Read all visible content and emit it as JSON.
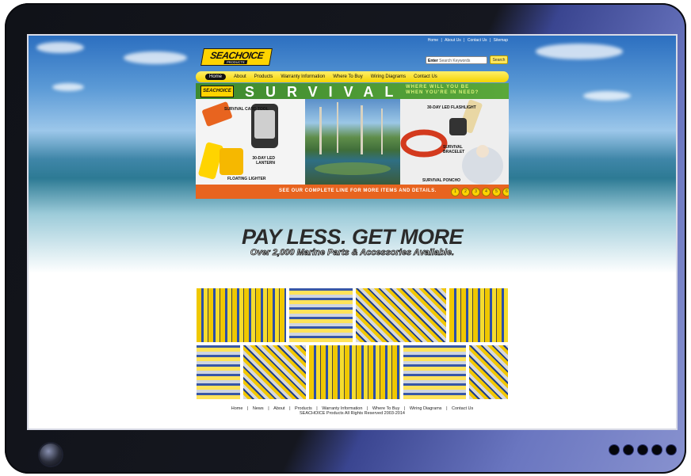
{
  "site": {
    "top_links": [
      "Home",
      "|",
      "About Us",
      "|",
      "Contact Us",
      "|",
      "Sitemap"
    ],
    "logo_text": "SEACHOICE",
    "logo_sub": "PRODUCTS",
    "search_prefix": "Enter",
    "search_placeholder": "Search Keywords",
    "search_button": "Search"
  },
  "nav": [
    "Home",
    "About",
    "Products",
    "Warranty Information",
    "Where To Buy",
    "Wiring Diagrams",
    "Contact Us"
  ],
  "banner": {
    "logo_mini": "SEACHOICE",
    "title": "SURVIVAL",
    "question_line1": "WHERE WILL YOU BE",
    "question_line2": "WHEN YOU'RE IN NEED?",
    "items": {
      "card_tool": "SURVIVAL CARD TOOL",
      "lantern": "30-DAY LED LANTERN",
      "lighter": "FLOATING LIGHTER",
      "flashlight": "30-DAY LED FLASHLIGHT",
      "bracelet": "SURVIVAL BRACELET",
      "poncho": "SURVIVAL PONCHO"
    },
    "footer_text": "SEE OUR COMPLETE LINE FOR MORE ITEMS AND DETAILS.",
    "pager": [
      "1",
      "2",
      "3",
      "4",
      "5",
      "6"
    ]
  },
  "slogan": {
    "main": "PAY LESS. GET MORE",
    "sub": "Over 2,000 Marine Parts & Accessories Available."
  },
  "footer": {
    "links": [
      "Home",
      "|",
      "News",
      "|",
      "About",
      "|",
      "Products",
      "|",
      "Warranty Information",
      "|",
      "Where To Buy",
      "|",
      "Wiring Diagrams",
      "|",
      "Contact Us"
    ],
    "copyright": "SEACHOICE Products All Rights Reserved 2003-2014"
  }
}
